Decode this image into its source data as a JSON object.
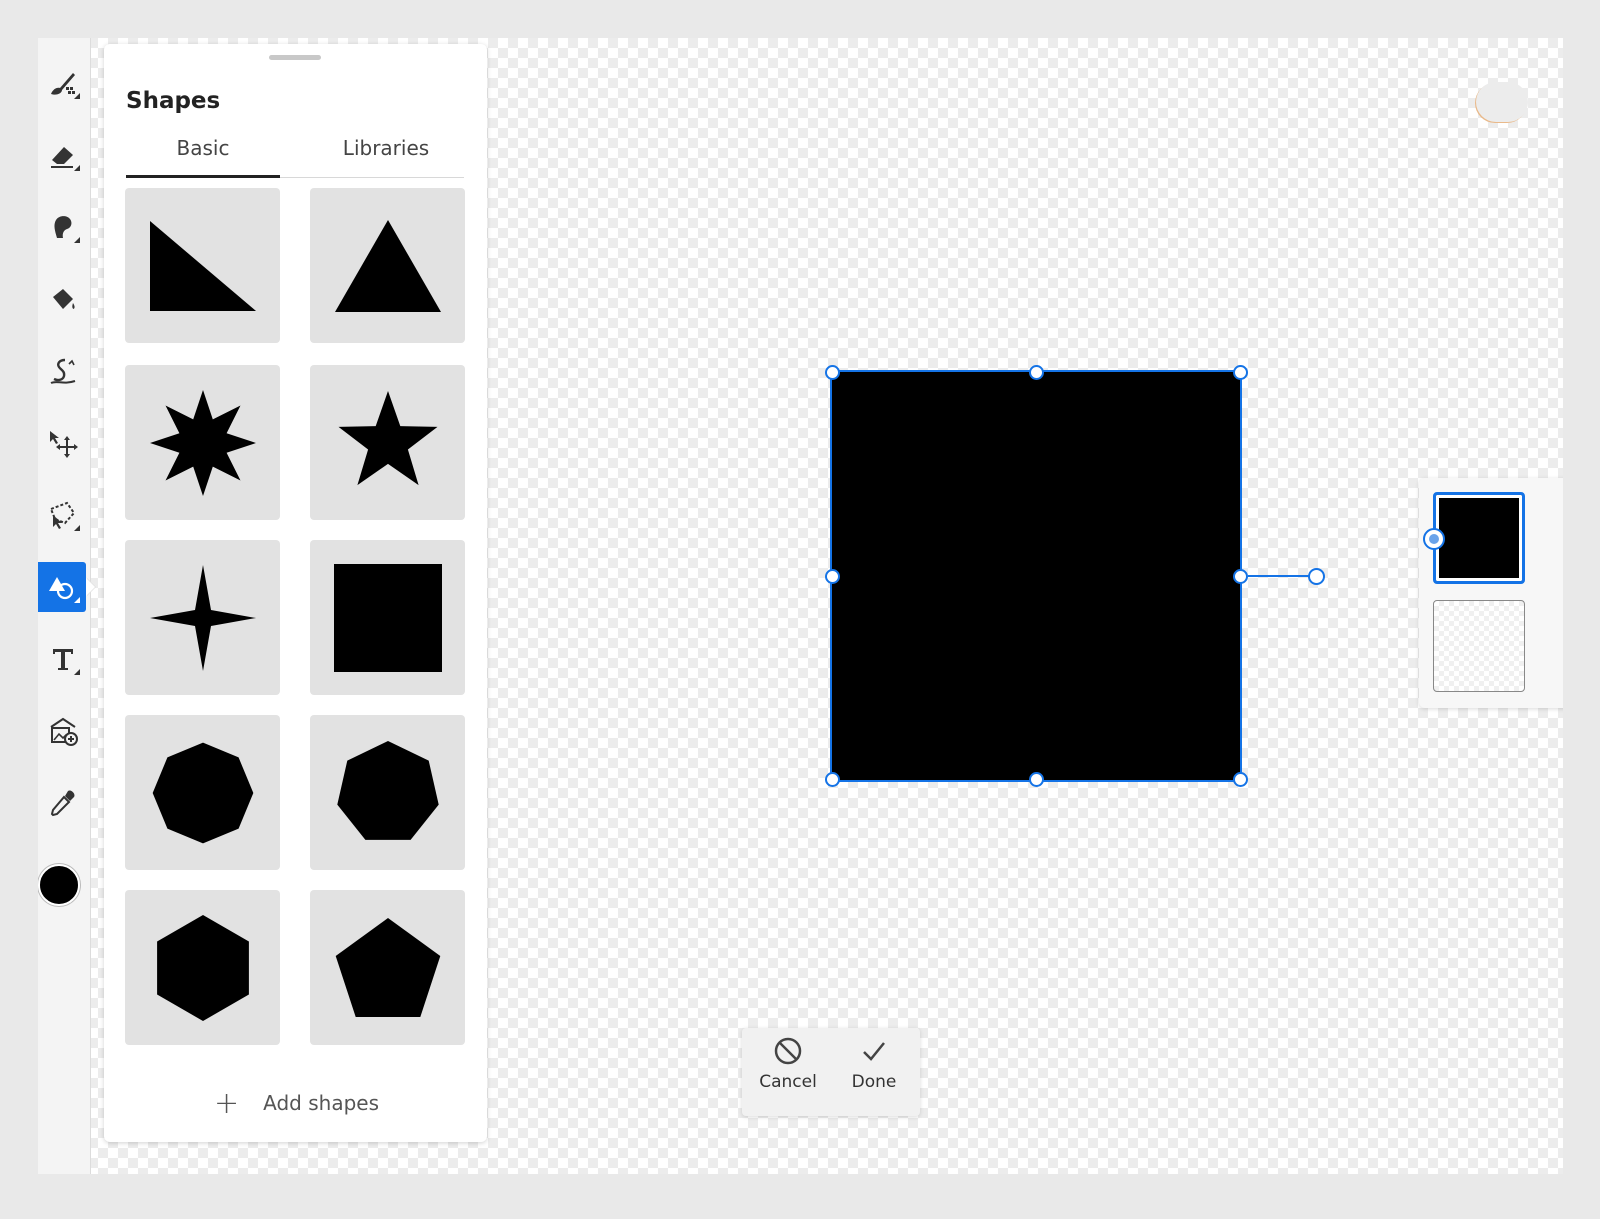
{
  "shapes_panel": {
    "title": "Shapes",
    "tabs": [
      {
        "label": "Basic",
        "active": true
      },
      {
        "label": "Libraries",
        "active": false
      }
    ],
    "shapes": [
      {
        "name": "right-triangle"
      },
      {
        "name": "triangle"
      },
      {
        "name": "eight-point-starburst"
      },
      {
        "name": "five-point-star"
      },
      {
        "name": "four-point-star"
      },
      {
        "name": "square"
      },
      {
        "name": "octagon"
      },
      {
        "name": "heptagon"
      },
      {
        "name": "hexagon"
      },
      {
        "name": "pentagon"
      }
    ],
    "add_shapes_label": "Add shapes"
  },
  "toolbar": {
    "tools": [
      {
        "icon": "pixel-brush-icon",
        "active": false
      },
      {
        "icon": "eraser-icon",
        "active": false
      },
      {
        "icon": "smudge-icon",
        "active": false
      },
      {
        "icon": "fill-bucket-icon",
        "active": false
      },
      {
        "icon": "liquify-icon",
        "active": false
      },
      {
        "icon": "transform-move-icon",
        "active": false
      },
      {
        "icon": "lasso-selection-icon",
        "active": false
      },
      {
        "icon": "shapes-tool-icon",
        "active": true
      },
      {
        "icon": "text-tool-icon",
        "active": false
      },
      {
        "icon": "add-image-icon",
        "active": false
      },
      {
        "icon": "eyedropper-icon",
        "active": false
      }
    ],
    "current_color": "#000000"
  },
  "canvas": {
    "selected_shape": "square",
    "fill_color": "#000000",
    "selection_color": "#1473e6"
  },
  "actions": {
    "cancel_label": "Cancel",
    "done_label": "Done"
  },
  "layers": [
    {
      "name": "shape-layer",
      "selected": true
    },
    {
      "name": "empty-layer",
      "selected": false
    }
  ]
}
